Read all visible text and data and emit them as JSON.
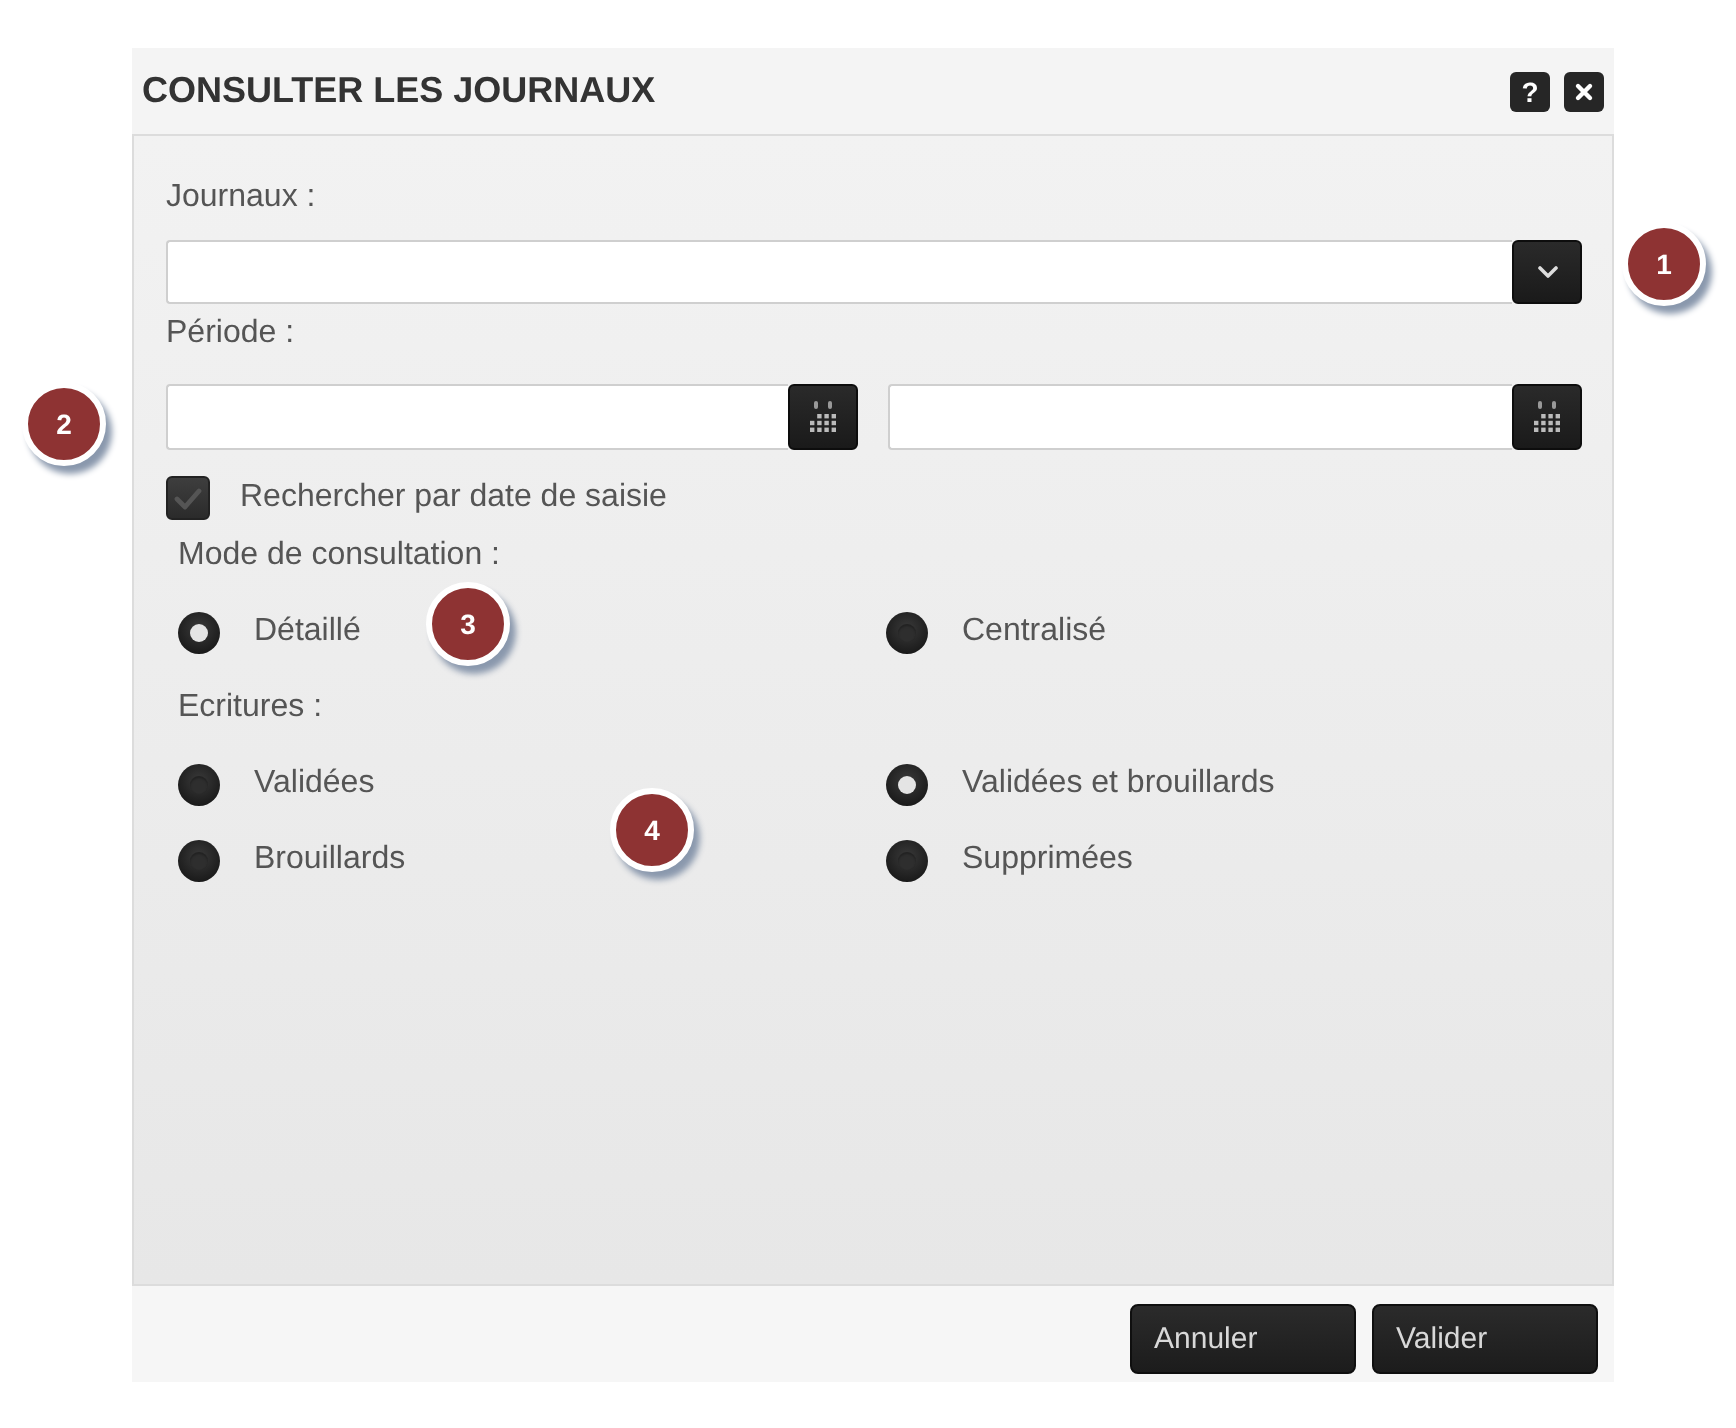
{
  "window": {
    "title": "CONSULTER LES JOURNAUX",
    "help_button": {
      "label": "?"
    }
  },
  "journaux": {
    "label": "Journaux :",
    "callout": "1"
  },
  "periode": {
    "label": "Période :",
    "callout": "2"
  },
  "date_saisie": {
    "label": "Rechercher par date de saisie",
    "checked": true
  },
  "mode_consultation": {
    "label": "Mode de consultation :",
    "callout": "3",
    "options": [
      {
        "label": "Détaillé",
        "selected": true
      },
      {
        "label": "Centralisé",
        "selected": false
      }
    ]
  },
  "ecritures": {
    "label": "Ecritures :",
    "callout": "4",
    "options": [
      {
        "label": "Validées",
        "selected": false
      },
      {
        "label": "Validées et brouillards",
        "selected": true
      },
      {
        "label": "Brouillards",
        "selected": false
      },
      {
        "label": "Supprimées",
        "selected": false
      }
    ]
  },
  "buttons": [
    {
      "label": "Annuler"
    },
    {
      "label": "Valider"
    }
  ]
}
